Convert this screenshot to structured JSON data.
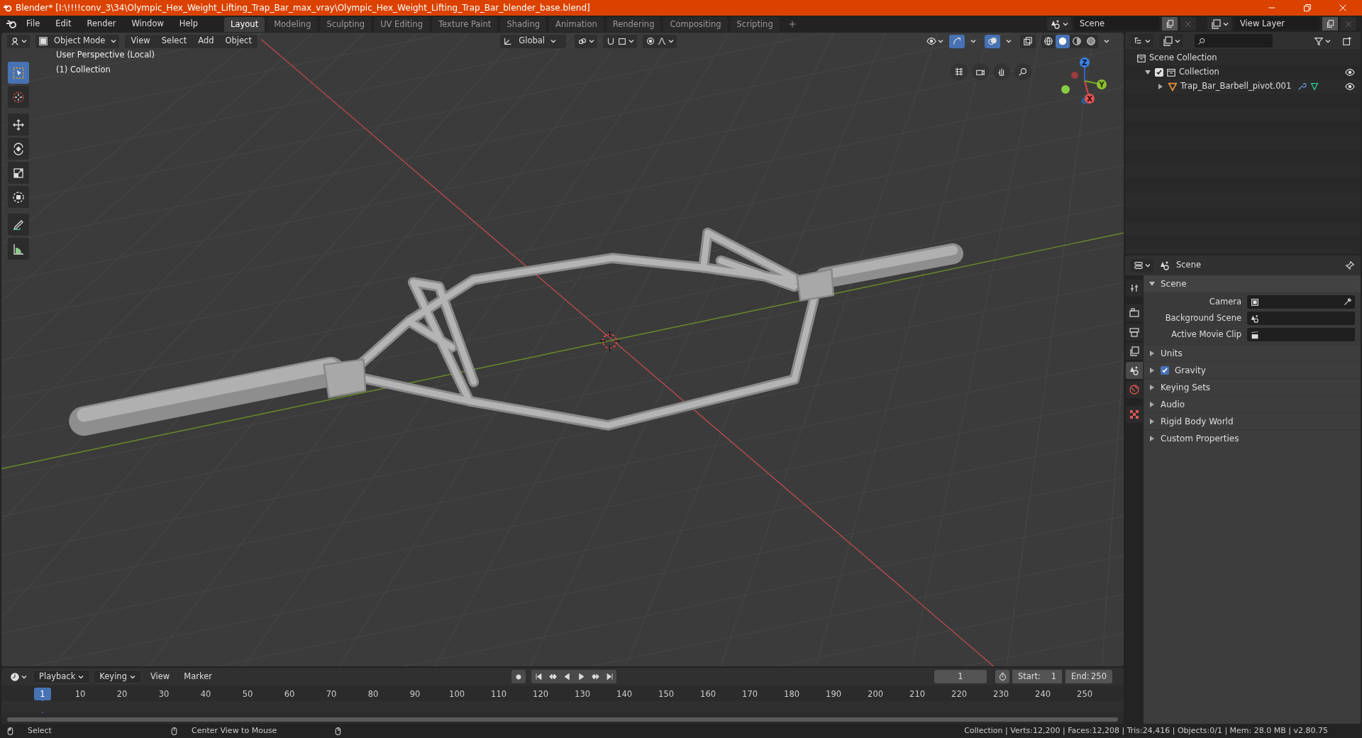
{
  "window": {
    "title": "Blender* [I:\\!!!!conv_3\\34\\Olympic_Hex_Weight_Lifting_Trap_Bar_max_vray\\Olympic_Hex_Weight_Lifting_Trap_Bar_blender_base.blend]"
  },
  "menu": [
    "File",
    "Edit",
    "Render",
    "Window",
    "Help"
  ],
  "workspaces": [
    {
      "label": "Layout",
      "selected": true
    },
    {
      "label": "Modeling",
      "selected": false
    },
    {
      "label": "Sculpting",
      "selected": false
    },
    {
      "label": "UV Editing",
      "selected": false
    },
    {
      "label": "Texture Paint",
      "selected": false
    },
    {
      "label": "Shading",
      "selected": false
    },
    {
      "label": "Animation",
      "selected": false
    },
    {
      "label": "Rendering",
      "selected": false
    },
    {
      "label": "Compositing",
      "selected": false
    },
    {
      "label": "Scripting",
      "selected": false
    }
  ],
  "scene_selector": {
    "value": "Scene"
  },
  "view_layer_selector": {
    "value": "View Layer"
  },
  "viewport_header": {
    "mode": "Object Mode",
    "menus": [
      "View",
      "Select",
      "Add",
      "Object"
    ],
    "orientation": "Global",
    "gizmos_on": true,
    "overlays_on": true,
    "shading": [
      {
        "kind": "wireframe",
        "selected": false
      },
      {
        "kind": "solid",
        "selected": true
      },
      {
        "kind": "material",
        "selected": false
      },
      {
        "kind": "rendered",
        "selected": false
      }
    ]
  },
  "tools": [
    {
      "kind": "select",
      "selected": true
    },
    {
      "kind": "cursor",
      "selected": false
    },
    {
      "kind": "move",
      "selected": false
    },
    {
      "kind": "rotate",
      "selected": false
    },
    {
      "kind": "scale",
      "selected": false
    },
    {
      "kind": "transform",
      "selected": false
    },
    {
      "kind": "annotate",
      "selected": false
    },
    {
      "kind": "measure",
      "selected": false
    }
  ],
  "viewport": {
    "perspective": "User Perspective (Local)",
    "collection": "(1) Collection",
    "gizmo_axes": [
      "X",
      "Y",
      "Z"
    ]
  },
  "outliner": {
    "items": [
      {
        "label": "Scene Collection",
        "kind": "scene_collection",
        "children": [
          {
            "label": "Collection",
            "kind": "collection",
            "checked": true,
            "visible": true,
            "expanded": true,
            "children": [
              {
                "label": "Trap_Bar_Barbell_pivot.001",
                "kind": "mesh",
                "visible": true,
                "expanded": false
              }
            ]
          }
        ]
      }
    ]
  },
  "properties": {
    "context": "Scene",
    "tabs": [
      {
        "kind": "tool",
        "selected": false
      },
      {
        "kind": "render",
        "selected": false
      },
      {
        "kind": "output",
        "selected": false
      },
      {
        "kind": "view_layer",
        "selected": false
      },
      {
        "kind": "scene",
        "selected": true
      },
      {
        "kind": "world",
        "selected": false
      },
      {
        "kind": "texture",
        "selected": false
      }
    ],
    "panel": {
      "title": "Scene",
      "expanded": true,
      "fields": [
        {
          "label": "Camera",
          "kind": "camera"
        },
        {
          "label": "Background Scene",
          "kind": "scene"
        },
        {
          "label": "Active Movie Clip",
          "kind": "clip"
        }
      ]
    },
    "subpanels": [
      {
        "label": "Units",
        "expanded": false
      },
      {
        "label": "Gravity",
        "expanded": false,
        "checked": true
      },
      {
        "label": "Keying Sets",
        "expanded": false
      },
      {
        "label": "Audio",
        "expanded": false
      },
      {
        "label": "Rigid Body World",
        "expanded": false
      },
      {
        "label": "Custom Properties",
        "expanded": false
      }
    ]
  },
  "timeline": {
    "menus": [
      {
        "label": "Playback",
        "dropdown": true
      },
      {
        "label": "Keying",
        "dropdown": true
      },
      {
        "label": "View",
        "dropdown": false
      },
      {
        "label": "Marker",
        "dropdown": false
      }
    ],
    "current_frame": "1",
    "start_label": "Start:",
    "start": "1",
    "end_label": "End:",
    "end": "250",
    "ruler": [
      "1",
      "10",
      "20",
      "30",
      "40",
      "50",
      "60",
      "70",
      "80",
      "90",
      "100",
      "110",
      "120",
      "130",
      "140",
      "150",
      "160",
      "170",
      "180",
      "190",
      "200",
      "210",
      "220",
      "230",
      "240",
      "250"
    ]
  },
  "status_bar": {
    "hints": [
      "Select",
      "Center View to Mouse"
    ],
    "stats": "Collection | Verts:12,200 | Faces:12,208 | Tris:24,416 | Objects:0/1 | Mem: 28.0 MB | v2.80.75"
  }
}
